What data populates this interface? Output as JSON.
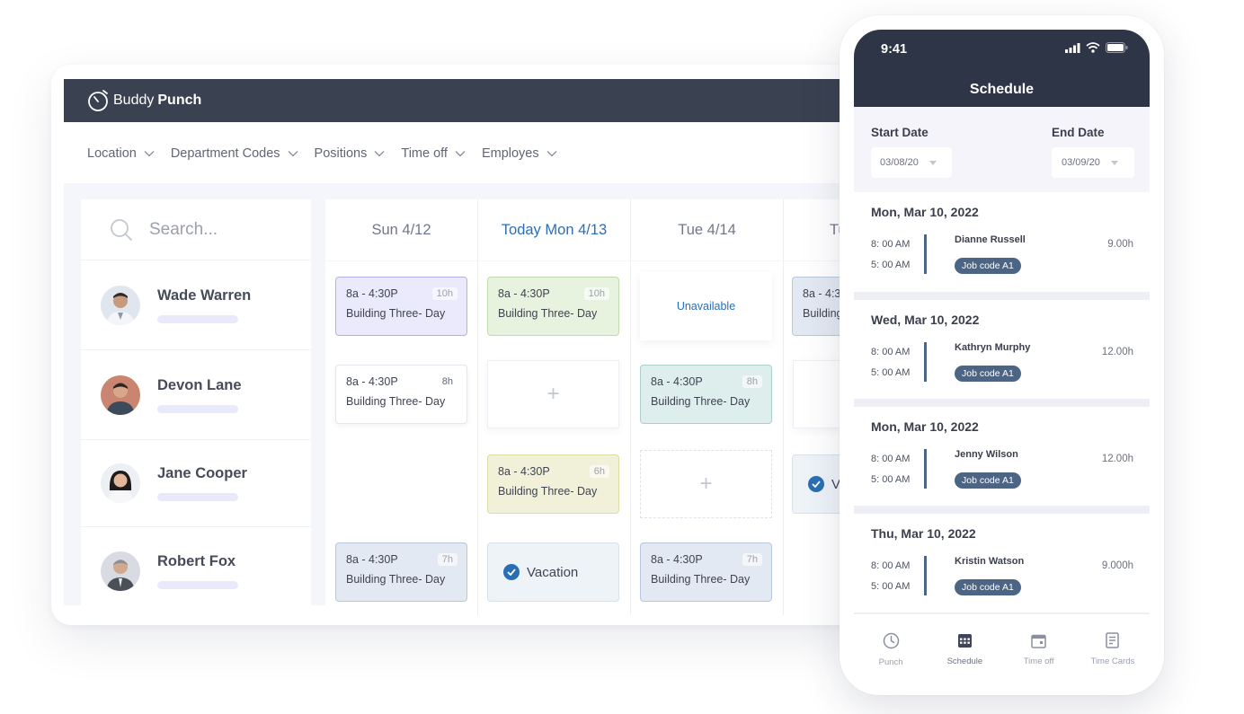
{
  "brand": {
    "name_light": "Buddy",
    "name_bold": "Punch"
  },
  "filters": [
    {
      "label": "Location"
    },
    {
      "label": "Department Codes"
    },
    {
      "label": "Positions"
    },
    {
      "label": "Time off"
    },
    {
      "label": "Employes"
    }
  ],
  "search": {
    "placeholder": "Search..."
  },
  "employees": [
    {
      "name": "Wade Warren"
    },
    {
      "name": "Devon Lane"
    },
    {
      "name": "Jane Cooper"
    },
    {
      "name": "Robert Fox"
    }
  ],
  "days": [
    {
      "label": "Sun 4/12"
    },
    {
      "label": "Today Mon 4/13"
    },
    {
      "label": "Tue 4/14"
    },
    {
      "label": "Tu"
    }
  ],
  "shifts": {
    "wade_sun": {
      "time": "8a - 4:30P",
      "hours": "10h",
      "place": "Building Three- Day"
    },
    "wade_mon": {
      "time": "8a - 4:30P",
      "hours": "10h",
      "place": "Building Three- Day"
    },
    "wade_tue": {
      "status": "Unavailable"
    },
    "wade_wed": {
      "time": "8a - 4:3",
      "place": "Building"
    },
    "devon_sun": {
      "time": "8a - 4:30P",
      "hours": "8h",
      "place": "Building Three- Day"
    },
    "devon_mon": {
      "add": "+"
    },
    "devon_tue": {
      "time": "8a - 4:30P",
      "hours": "8h",
      "place": "Building Three- Day"
    },
    "jane_mon": {
      "time": "8a - 4:30P",
      "hours": "6h",
      "place": "Building Three- Day"
    },
    "jane_tue": {
      "add": "+"
    },
    "jane_wed": {
      "status": "Va"
    },
    "robert_sun": {
      "time": "8a - 4:30P",
      "hours": "7h",
      "place": "Building Three- Day"
    },
    "robert_mon": {
      "status": "Vacation"
    },
    "robert_tue": {
      "time": "8a - 4:30P",
      "hours": "7h",
      "place": "Building Three- Day"
    }
  },
  "phone": {
    "status_time": "9:41",
    "title": "Schedule",
    "start_date": {
      "label": "Start Date",
      "value": "03/08/20"
    },
    "end_date": {
      "label": "End Date",
      "value": "03/09/20"
    },
    "entries": [
      {
        "date": "Mon, Mar 10, 2022",
        "start": "8: 00 AM",
        "end": "5: 00 AM",
        "name": "Dianne Russell",
        "job": "Job code A1",
        "hours": "9.00h"
      },
      {
        "date": "Wed, Mar 10, 2022",
        "start": "8: 00 AM",
        "end": "5: 00 AM",
        "name": "Kathryn Murphy",
        "job": "Job code A1",
        "hours": "12.00h"
      },
      {
        "date": "Mon, Mar 10, 2022",
        "start": "8: 00 AM",
        "end": "5: 00 AM",
        "name": "Jenny Wilson",
        "job": "Job code A1",
        "hours": "12.00h"
      },
      {
        "date": "Thu, Mar 10, 2022",
        "start": "8: 00 AM",
        "end": "5: 00 AM",
        "name": "Kristin Watson",
        "job": "Job code A1",
        "hours": "9.000h"
      }
    ],
    "tabs": [
      {
        "label": "Punch",
        "icon": "clock-icon"
      },
      {
        "label": "Schedule",
        "icon": "schedule-icon"
      },
      {
        "label": "Time off",
        "icon": "calendar-icon"
      },
      {
        "label": "Time Cards",
        "icon": "timecard-icon"
      }
    ]
  },
  "colors": {
    "header": "#3a4150",
    "phone_header": "#2e3546",
    "accent": "#2a6fb5",
    "badge": "#4d6585"
  }
}
